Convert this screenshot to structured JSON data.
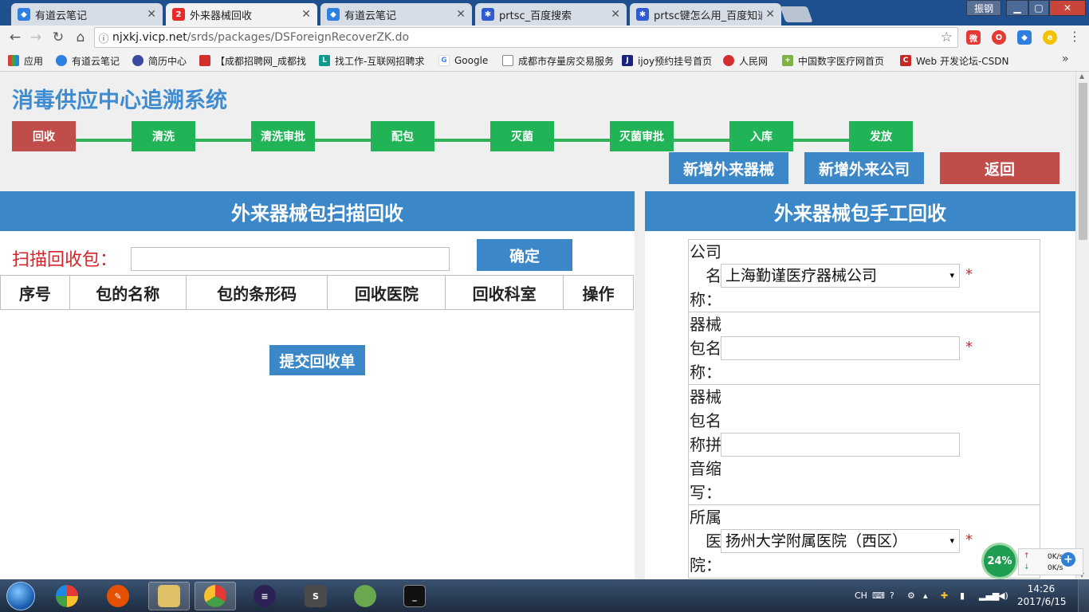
{
  "browser": {
    "tabs": [
      {
        "title": "有道云笔记",
        "active": false,
        "icon": "youdao-note-icon"
      },
      {
        "title": "外来器械回收",
        "active": true,
        "icon": "app-logo-icon"
      },
      {
        "title": "有道云笔记",
        "active": false,
        "icon": "youdao-note-icon"
      },
      {
        "title": "prtsc_百度搜索",
        "active": false,
        "icon": "baidu-paw-icon"
      },
      {
        "title": "prtsc键怎么用_百度知道",
        "active": false,
        "icon": "baidu-paw-icon"
      }
    ],
    "user_button": "振钢",
    "url_host": "njxkj.vicp.net",
    "url_path": "/srds/packages/DSForeignRecoverZK.do",
    "bookmarks": [
      {
        "label": "应用",
        "icon": "apps-grid-icon"
      },
      {
        "label": "有道云笔记",
        "icon": "youdao-note-icon"
      },
      {
        "label": "简历中心",
        "icon": "globe-icon"
      },
      {
        "label": "【成都招聘网_成都找",
        "icon": "bird-icon"
      },
      {
        "label": "找工作-互联网招聘求",
        "icon": "lagou-icon"
      },
      {
        "label": "Google",
        "icon": "google-icon"
      },
      {
        "label": "成都市存量房交易服务",
        "icon": "page-icon"
      },
      {
        "label": "ijoy预约挂号首页",
        "icon": "ijoy-icon"
      },
      {
        "label": "人民网",
        "icon": "people-daily-icon"
      },
      {
        "label": "中国数字医疗网首页",
        "icon": "medical-cross-icon"
      },
      {
        "label": "Web 开发论坛-CSDN",
        "icon": "csdn-icon"
      }
    ]
  },
  "page": {
    "system_title": "消毒供应中心追溯系统",
    "steps": [
      "回收",
      "清洗",
      "清洗审批",
      "配包",
      "灭菌",
      "灭菌审批",
      "入库",
      "发放"
    ],
    "current_step": "回收",
    "actions": {
      "new_instrument": "新增外来器械",
      "new_company": "新增外来公司",
      "back": "返回"
    },
    "scan_panel": {
      "title": "外来器械包扫描回收",
      "scan_label": "扫描回收包：",
      "scan_value": "",
      "confirm": "确定",
      "columns": [
        "序号",
        "包的名称",
        "包的条形码",
        "回收医院",
        "回收科室",
        "操作"
      ],
      "submit": "提交回收单"
    },
    "manual_panel": {
      "title": "外来器械包手工回收",
      "company_label_1": "公司",
      "company_label_2": "名",
      "company_label_3": "称：",
      "company_value": "上海勤谨医疗器械公司",
      "package_label_1": "器械",
      "package_label_2": "包名",
      "package_label_3": "称：",
      "package_value": "",
      "pinyin_label_1": "器械",
      "pinyin_label_2": "包名",
      "pinyin_label_3": "称拼",
      "pinyin_label_4": "音缩",
      "pinyin_label_5": "写：",
      "pinyin_value": "",
      "hospital_label_1": "所属",
      "hospital_label_2": "医",
      "hospital_label_3": "院：",
      "hospital_value": "扬州大学附属医院（西区）",
      "required_mark": "*",
      "dropdown_caret": "▾"
    }
  },
  "overlay": {
    "net_percent": "24%",
    "upload_speed": "0K/s",
    "download_speed": "0K/s"
  },
  "taskbar": {
    "lang": "CH",
    "time": "14:26",
    "date": "2017/6/15"
  },
  "colors": {
    "brand_blue": "#3b87c8",
    "step_green": "#20b457",
    "active_red": "#c04d4a",
    "required_red": "#d9232a"
  }
}
